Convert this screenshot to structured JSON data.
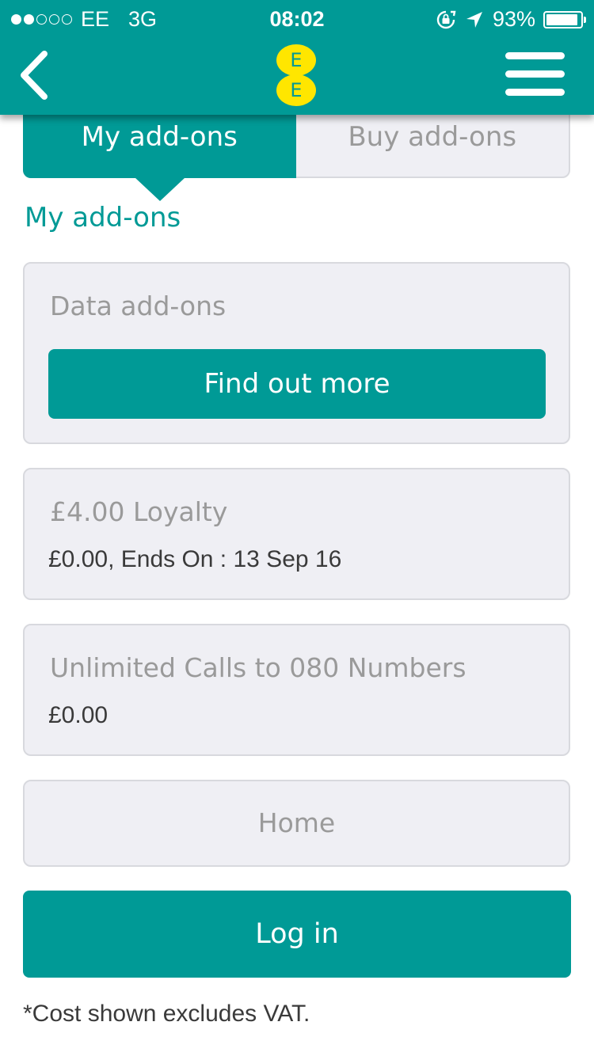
{
  "status_bar": {
    "signal_filled": 2,
    "signal_total": 5,
    "carrier": "EE",
    "network": "3G",
    "time": "08:02",
    "battery_percent": "93%",
    "battery_level": 0.93,
    "icons": [
      "rotation-lock-icon",
      "location-arrow-icon",
      "battery-icon"
    ]
  },
  "header": {
    "back_icon": "chevron-left-icon",
    "logo_letters": [
      "E",
      "E"
    ],
    "logo_color": "#ffe600",
    "menu_icon": "hamburger-menu-icon",
    "background_color": "#009a96"
  },
  "tabs": [
    {
      "label": "My add-ons",
      "active": true
    },
    {
      "label": "Buy add-ons",
      "active": false
    }
  ],
  "section_title": "My add-ons",
  "cards": {
    "data": {
      "title": "Data add-ons",
      "button_label": "Find out more"
    },
    "loyalty": {
      "title": "£4.00 Loyalty",
      "detail": "£0.00, Ends On : 13 Sep 16"
    },
    "calls": {
      "title": "Unlimited Calls to 080 Numbers",
      "detail": "£0.00"
    },
    "home": {
      "label": "Home"
    }
  },
  "login_button": "Log in",
  "footnote": "*Cost shown excludes VAT.",
  "colors": {
    "accent": "#009a96",
    "card_background": "#efeff4",
    "muted_text": "#9a9a9a"
  }
}
